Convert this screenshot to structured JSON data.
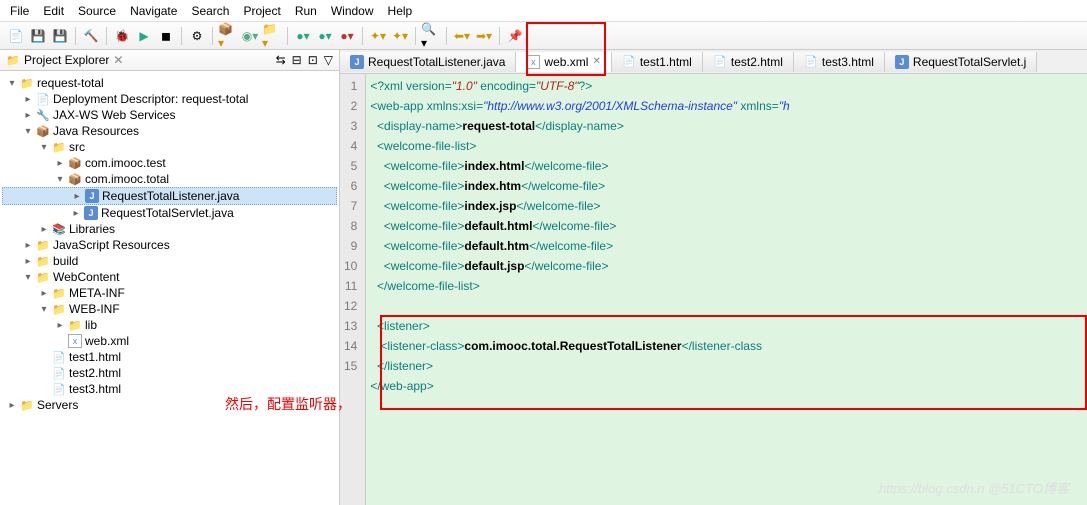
{
  "menu": [
    "File",
    "Edit",
    "Source",
    "Navigate",
    "Search",
    "Project",
    "Run",
    "Window",
    "Help"
  ],
  "explorer": {
    "title": "Project Explorer",
    "tree": [
      {
        "d": 0,
        "tw": "▾",
        "icon": "📁",
        "label": "request-total",
        "color": "#c79a00"
      },
      {
        "d": 1,
        "tw": "▸",
        "icon": "📄",
        "label": "Deployment Descriptor: request-total"
      },
      {
        "d": 1,
        "tw": "▸",
        "icon": "🔧",
        "label": "JAX-WS Web Services"
      },
      {
        "d": 1,
        "tw": "▾",
        "icon": "📦",
        "label": "Java Resources",
        "color": "#c79a00"
      },
      {
        "d": 2,
        "tw": "▾",
        "icon": "📁",
        "label": "src",
        "color": "#c79a00"
      },
      {
        "d": 3,
        "tw": "▸",
        "icon": "📦",
        "label": "com.imooc.test"
      },
      {
        "d": 3,
        "tw": "▾",
        "icon": "📦",
        "label": "com.imooc.total"
      },
      {
        "d": 4,
        "tw": "▸",
        "icon": "J",
        "label": "RequestTotalListener.java",
        "sel": true
      },
      {
        "d": 4,
        "tw": "▸",
        "icon": "J",
        "label": "RequestTotalServlet.java"
      },
      {
        "d": 2,
        "tw": "▸",
        "icon": "📚",
        "label": "Libraries"
      },
      {
        "d": 1,
        "tw": "▸",
        "icon": "📁",
        "label": "JavaScript Resources",
        "color": "#c79a00"
      },
      {
        "d": 1,
        "tw": "▸",
        "icon": "📁",
        "label": "build"
      },
      {
        "d": 1,
        "tw": "▾",
        "icon": "📁",
        "label": "WebContent",
        "color": "#c79a00"
      },
      {
        "d": 2,
        "tw": "▸",
        "icon": "📁",
        "label": "META-INF",
        "color": "#c79a00"
      },
      {
        "d": 2,
        "tw": "▾",
        "icon": "📁",
        "label": "WEB-INF",
        "color": "#c79a00"
      },
      {
        "d": 3,
        "tw": "▸",
        "icon": "📁",
        "label": "lib",
        "color": "#c79a00"
      },
      {
        "d": 3,
        "tw": "",
        "icon": "x",
        "label": "web.xml"
      },
      {
        "d": 2,
        "tw": "",
        "icon": "📄",
        "label": "test1.html"
      },
      {
        "d": 2,
        "tw": "",
        "icon": "📄",
        "label": "test2.html"
      },
      {
        "d": 2,
        "tw": "",
        "icon": "📄",
        "label": "test3.html"
      },
      {
        "d": 0,
        "tw": "▸",
        "icon": "📁",
        "label": "Servers"
      }
    ]
  },
  "tabs": [
    {
      "icon": "J",
      "label": "RequestTotalListener.java"
    },
    {
      "icon": "x",
      "label": "web.xml",
      "active": true,
      "close": true
    },
    {
      "icon": "📄",
      "label": "test1.html"
    },
    {
      "icon": "📄",
      "label": "test2.html"
    },
    {
      "icon": "📄",
      "label": "test3.html"
    },
    {
      "icon": "J",
      "label": "RequestTotalServlet.j"
    }
  ],
  "code": {
    "lines": [
      {
        "n": 1,
        "html": "<span class='pi'>&lt;?xml</span> <span class='tag'>version=</span><span class='attr'>\"1.0\"</span> <span class='tag'>encoding=</span><span class='attr'>\"UTF-8\"</span><span class='pi'>?&gt;</span>"
      },
      {
        "n": 2,
        "html": "<span class='tag'>&lt;web-app</span> <span class='tag'>xmlns:xsi=</span><span class='val'>\"http://www.w3.org/2001/XMLSchema-instance\"</span> <span class='tag'>xmlns=</span><span class='val'>\"h</span>"
      },
      {
        "n": 3,
        "html": "  <span class='tag'>&lt;display-name&gt;</span><span class='txt'>request-total</span><span class='tag'>&lt;/display-name&gt;</span>"
      },
      {
        "n": 4,
        "html": "  <span class='tag'>&lt;welcome-file-list&gt;</span>"
      },
      {
        "n": 5,
        "html": "    <span class='tag'>&lt;welcome-file&gt;</span><span class='txt'>index.html</span><span class='tag'>&lt;/welcome-file&gt;</span>"
      },
      {
        "n": 6,
        "html": "    <span class='tag'>&lt;welcome-file&gt;</span><span class='txt'>index.htm</span><span class='tag'>&lt;/welcome-file&gt;</span>"
      },
      {
        "n": 7,
        "html": "    <span class='tag'>&lt;welcome-file&gt;</span><span class='txt'>index.jsp</span><span class='tag'>&lt;/welcome-file&gt;</span>"
      },
      {
        "n": 8,
        "html": "    <span class='tag'>&lt;welcome-file&gt;</span><span class='txt'>default.html</span><span class='tag'>&lt;/welcome-file&gt;</span>"
      },
      {
        "n": 9,
        "html": "    <span class='tag'>&lt;welcome-file&gt;</span><span class='txt'>default.htm</span><span class='tag'>&lt;/welcome-file&gt;</span>"
      },
      {
        "n": 10,
        "html": "    <span class='tag'>&lt;welcome-file&gt;</span><span class='txt'>default.jsp</span><span class='tag'>&lt;/welcome-file&gt;</span>"
      },
      {
        "n": 11,
        "html": "  <span class='tag'>&lt;/welcome-file-list&gt;</span>"
      },
      {
        "n": 12,
        "html": "  "
      },
      {
        "n": 13,
        "html": "  <span class='tag'>&lt;listener&gt;</span>"
      },
      {
        "n": 14,
        "html": "   <span class='tag'>&lt;listener-class&gt;</span><span class='txt'>com.imooc.total.RequestTotalListener</span><span class='tag'>&lt;/listener-class</span>"
      },
      {
        "n": 15,
        "html": "  <span class='tag'>&lt;/listener&gt;</span>"
      },
      {
        "n": "",
        "html": "<span class='tag'>&lt;/web-app&gt;</span>"
      }
    ]
  },
  "annotation": "然后，配置监听器，",
  "watermark": "https://blog.csdn.n @51CTO博客"
}
